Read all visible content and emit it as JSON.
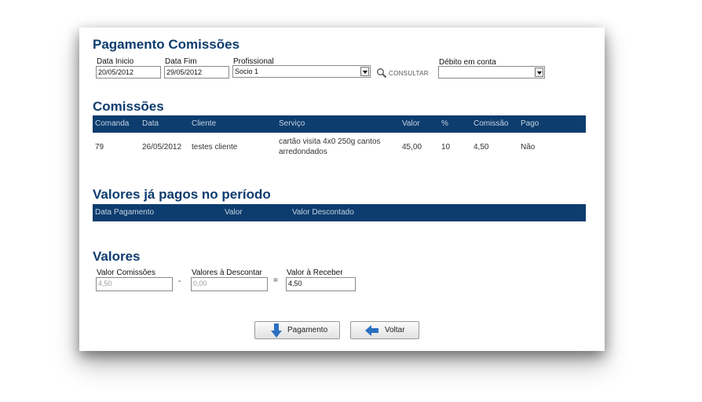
{
  "page_title": "Pagamento Comissões",
  "filters": {
    "data_inicio_label": "Data Inicio",
    "data_inicio_value": "20/05/2012",
    "data_fim_label": "Data Fim",
    "data_fim_value": "29/05/2012",
    "profissional_label": "Profissional",
    "profissional_value": "Socio 1",
    "consultar_label": "CONSULTAR",
    "debito_label": "Débito em conta",
    "debito_value": ""
  },
  "comissoes": {
    "title": "Comissões",
    "columns": [
      "Comanda",
      "Data",
      "Cliente",
      "Serviço",
      "Valor",
      "%",
      "Comissão",
      "Pago"
    ],
    "rows": [
      {
        "comanda": "79",
        "data": "26/05/2012",
        "cliente": "testes cliente",
        "servico": "cartão visita 4x0 250g cantos arredondados",
        "valor": "45,00",
        "percent": "10",
        "comissao": "4,50",
        "pago": "Não"
      }
    ]
  },
  "pagos": {
    "title": "Valores já pagos no período",
    "columns": [
      "Data Pagamento",
      "Valor",
      "Valor Descontado"
    ]
  },
  "valores": {
    "title": "Valores",
    "comissoes_label": "Valor Comissões",
    "comissoes_value": "4,50",
    "descontar_label": "Valores à Descontar",
    "descontar_value": "0,00",
    "minus": "-",
    "equals": "=",
    "receber_label": "Valor à Receber",
    "receber_value": "4,50"
  },
  "buttons": {
    "pagamento": "Pagamento",
    "voltar": "Voltar"
  },
  "colors": {
    "header_bg": "#0d3c6e",
    "title": "#0f3c6e",
    "icon_blue": "#2a6fc0"
  }
}
